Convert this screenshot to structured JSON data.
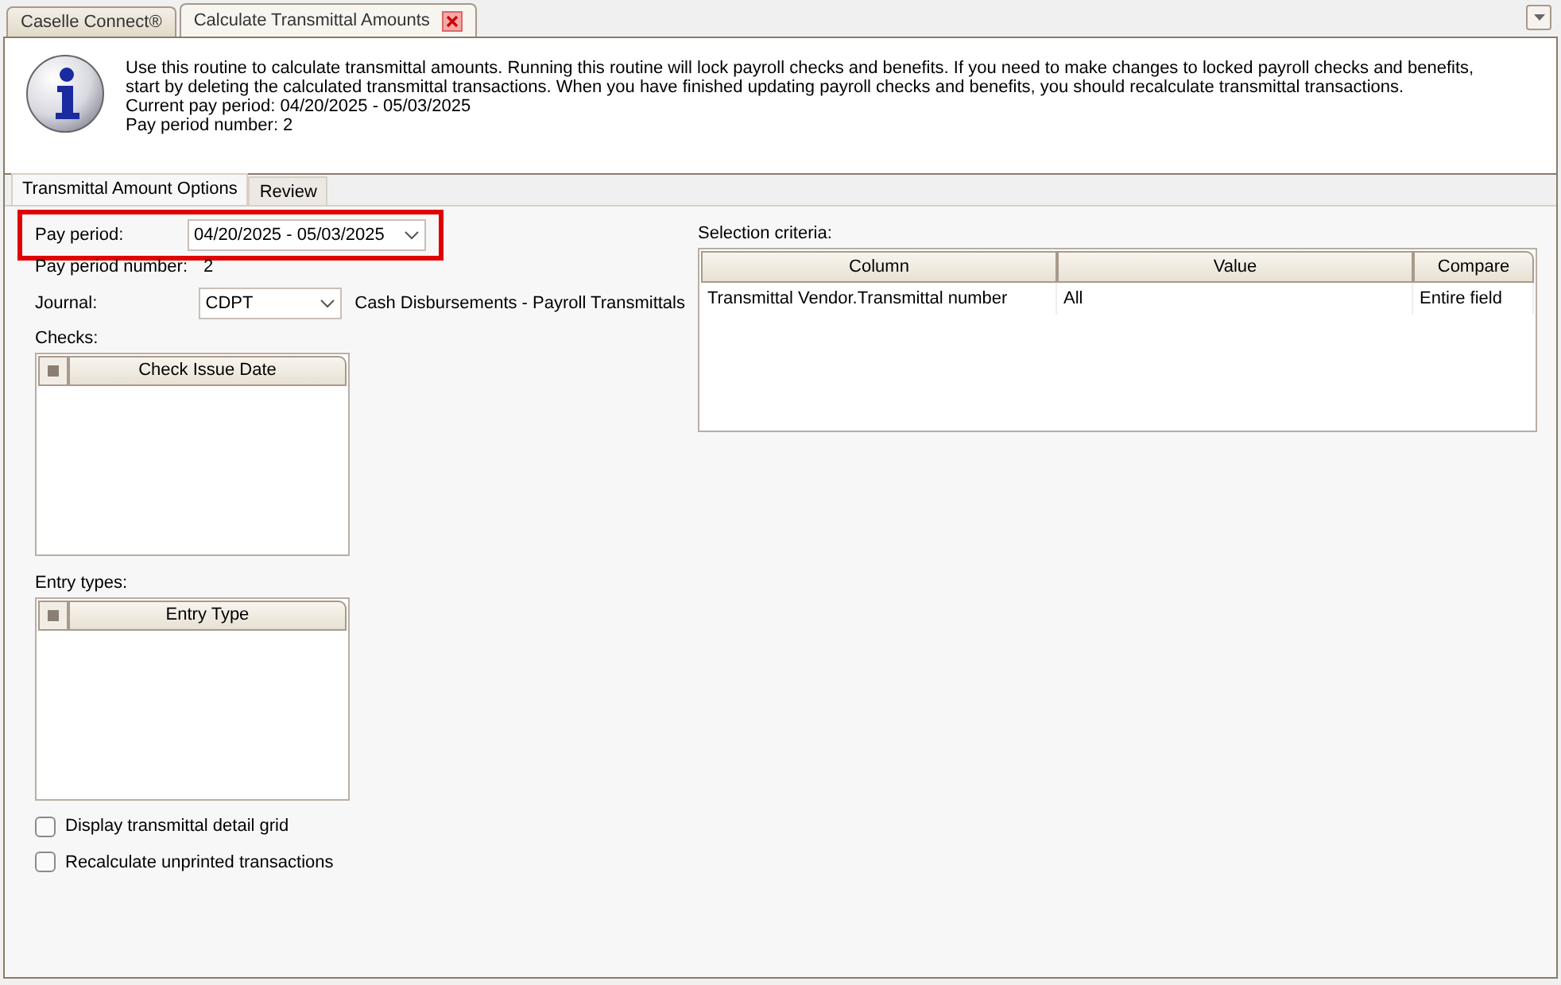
{
  "doc_tabs": [
    {
      "label": "Caselle Connect®",
      "selected": false,
      "closable": false
    },
    {
      "label": "Calculate Transmittal Amounts",
      "selected": true,
      "closable": true
    }
  ],
  "info": {
    "lines": [
      "Use this routine to calculate transmittal amounts. Running this routine will lock payroll checks and benefits. If you need to make changes to locked payroll checks and benefits,",
      "start by deleting the calculated transmittal transactions. When you have finished updating payroll checks and benefits, you should recalculate transmittal transactions.",
      "Current pay period: 04/20/2025 - 05/03/2025",
      "Pay period number: 2"
    ]
  },
  "tabs": [
    {
      "label": "Transmittal Amount Options",
      "selected": true
    },
    {
      "label": "Review",
      "selected": false
    }
  ],
  "pay_period": {
    "label": "Pay period:",
    "value": "04/20/2025 - 05/03/2025",
    "highlighted": true
  },
  "pay_period_number": {
    "label": "Pay period number:",
    "value": "2"
  },
  "journal": {
    "label": "Journal:",
    "value": "CDPT",
    "description": "Cash Disbursements - Payroll Transmittals"
  },
  "checks": {
    "label": "Checks:",
    "column": "Check Issue Date",
    "select_all_partial": true
  },
  "entry_types": {
    "label": "Entry types:",
    "column": "Entry Type",
    "select_all_partial": true
  },
  "options": [
    {
      "label": "Display transmittal detail grid",
      "checked": false
    },
    {
      "label": "Recalculate unprinted transactions",
      "checked": false
    }
  ],
  "selection_criteria": {
    "label": "Selection criteria:",
    "columns": [
      "Column",
      "Value",
      "Compare"
    ],
    "rows": [
      [
        "Transmittal Vendor.Transmittal number",
        "All",
        "Entire field"
      ]
    ]
  }
}
